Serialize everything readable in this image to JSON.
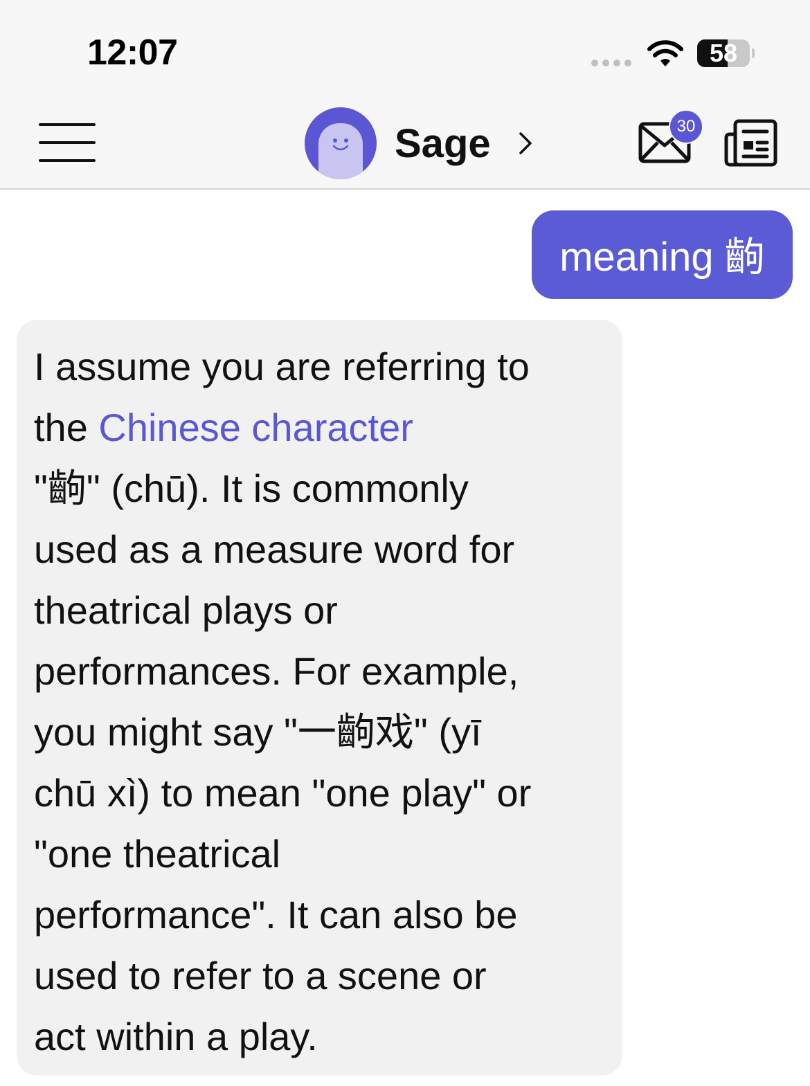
{
  "status_bar": {
    "time": "12:07",
    "battery_percent": 58,
    "battery_label": "58",
    "wifi_icon": "wifi-icon",
    "signal_icon": "cellular-signal-icon"
  },
  "header": {
    "menu_icon": "hamburger-menu-icon",
    "bot_name": "Sage",
    "chevron_icon": "chevron-right-icon",
    "mail_icon": "mail-icon",
    "mail_badge_count": "30",
    "news_icon": "newspaper-icon",
    "accent_color": "#5b57d4"
  },
  "messages": {
    "user": {
      "text": "meaning 齣"
    },
    "bot": {
      "line1": "I assume you are referring to",
      "line2_prefix": "the ",
      "line2_link": "Chinese character",
      "line3": "\"齣\" (chū). It is commonly",
      "line4": "used as a measure word for",
      "line5": "theatrical plays or",
      "line6": "performances. For example,",
      "line7": "you might say \"一齣戏\" (yī",
      "line8": "chū xì) to mean \"one play\" or",
      "line9": "\"one theatrical",
      "line10": "performance\". It can also be",
      "line11": "used to refer to a scene or",
      "line12": "act within a play."
    }
  },
  "colors": {
    "user_bubble": "#5b5bd6",
    "bot_bubble": "#f1f1f1",
    "link": "#5b57d4"
  }
}
